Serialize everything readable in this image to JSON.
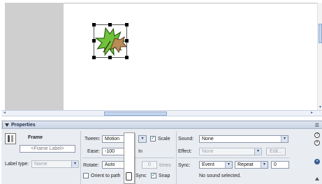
{
  "panel": {
    "title": "Properties",
    "frame": {
      "heading": "Frame",
      "label_value": "<Frame Label>",
      "label_type_label": "Label type:",
      "label_type_value": "Name"
    },
    "tween": {
      "label": "Tween:",
      "value": "Motion",
      "scale_label": "Scale",
      "scale_checked": true,
      "ease_label": "Ease:",
      "ease_value": "-100",
      "ease_suffix": "In",
      "rotate_label": "Rotate:",
      "rotate_value": "Auto",
      "times_value": "0",
      "times_label": "times",
      "orient_label": "Orient to path",
      "orient_checked": false,
      "sync_label": "Sync",
      "snap_label": "Snap",
      "snap_checked": true
    },
    "sound": {
      "label": "Sound:",
      "value": "None",
      "effect_label": "Effect:",
      "effect_value": "None",
      "edit_label": "Edit...",
      "sync_label": "Sync:",
      "sync_value": "Event",
      "repeat_value": "Repeat",
      "repeat_count": "0",
      "status": "No sound selected."
    }
  },
  "icons": {
    "collapse": "triangle-down-icon",
    "panel_menu": "options-menu-icon",
    "help": "help-icon",
    "code_hint": "code-hint-icon",
    "expand": "expand-icon",
    "frame_thumbnail": "frame-thumbnail-icon",
    "leaf": "maple-leaf-symbol"
  },
  "colors": {
    "leaf_green": "#6fc33a",
    "leaf_brown": "#b98b55",
    "scrollbar_accent": "#8ea8d0",
    "panel_bg": "#e9ecf1"
  }
}
